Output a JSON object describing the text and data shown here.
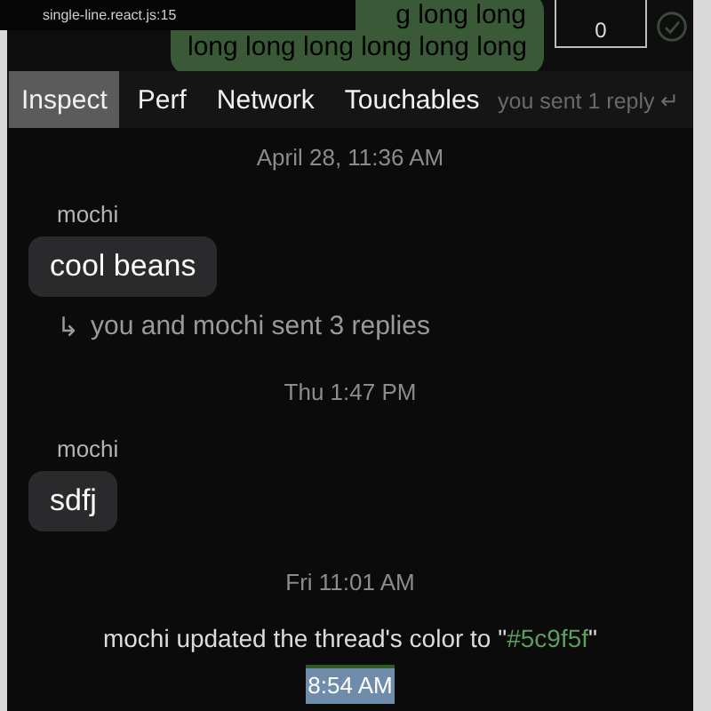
{
  "overlay": {
    "source": "single-line.react.js:15",
    "bubble_lines": [
      "g long long",
      "long long long long long long"
    ],
    "box_value": "0",
    "faded_reply": "you sent 1 reply ↵"
  },
  "tabs": [
    {
      "label": "Inspect",
      "selected": true
    },
    {
      "label": "Perf",
      "selected": false
    },
    {
      "label": "Network",
      "selected": false
    },
    {
      "label": "Touchables",
      "selected": false
    }
  ],
  "thread": [
    {
      "kind": "timestamp",
      "text": "April 28, 11:36 AM",
      "highlighted": false
    },
    {
      "kind": "sender",
      "text": "mochi"
    },
    {
      "kind": "bubble",
      "text": "cool beans"
    },
    {
      "kind": "replies",
      "arrow": "↳",
      "text": "you and mochi sent 3 replies"
    },
    {
      "kind": "timestamp",
      "text": "Thu 1:47 PM",
      "highlighted": false
    },
    {
      "kind": "sender",
      "text": "mochi"
    },
    {
      "kind": "bubble",
      "text": "sdfj"
    },
    {
      "kind": "timestamp",
      "text": "Fri 11:01 AM",
      "highlighted": false
    },
    {
      "kind": "system",
      "prefix": "mochi updated the thread's color to \"",
      "value": "#5c9f5f",
      "suffix": "\""
    },
    {
      "kind": "timestamp",
      "text": "8:54 AM",
      "highlighted": true
    }
  ]
}
